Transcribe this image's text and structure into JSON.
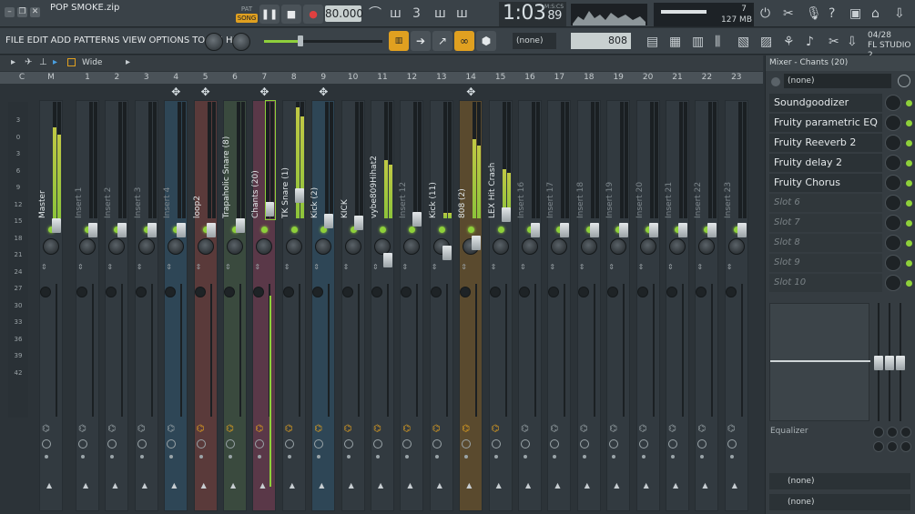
{
  "window": {
    "title": "POP SMOKE.zip"
  },
  "transport": {
    "pat_label": "PAT",
    "song_label": "SONG",
    "tempo": "80.000",
    "time": "1:03",
    "time_small": "89",
    "time_unit": "M:S:CS",
    "hint_cpu": "7",
    "hint_mem": "127 MB",
    "hint_poly": "6"
  },
  "menu": {
    "items": [
      "FILE",
      "EDIT",
      "ADD",
      "PATTERNS",
      "VIEW",
      "OPTIONS",
      "TOOLS",
      "HELP"
    ]
  },
  "toolbar": {
    "pattern_select": "(none)",
    "pattern_number": "808",
    "date": "04/28",
    "studio": "FL STUDIO 2.."
  },
  "mixer": {
    "view_mode": "Wide",
    "db_scale": [
      "3",
      "0",
      "3",
      "6",
      "9",
      "12",
      "15",
      "18",
      "21",
      "24",
      "27",
      "30",
      "33",
      "36",
      "39",
      "42"
    ],
    "strips": [
      {
        "num": "C",
        "label": ""
      },
      {
        "num": "M",
        "label": "Master"
      },
      {
        "num": "1",
        "label": "Insert 1"
      },
      {
        "num": "2",
        "label": "Insert 2"
      },
      {
        "num": "3",
        "label": "Insert 3"
      },
      {
        "num": "4",
        "label": "Insert 4"
      },
      {
        "num": "5",
        "label": "loop2"
      },
      {
        "num": "6",
        "label": "Trapaholic Snare (8)"
      },
      {
        "num": "7",
        "label": "Chants (20)"
      },
      {
        "num": "8",
        "label": "TK Snare (1)"
      },
      {
        "num": "9",
        "label": "Kick (2)"
      },
      {
        "num": "10",
        "label": "KICK"
      },
      {
        "num": "11",
        "label": "vybe809Hihat2"
      },
      {
        "num": "12",
        "label": "Insert 12"
      },
      {
        "num": "13",
        "label": "Kick (11)"
      },
      {
        "num": "14",
        "label": "808 (2)"
      },
      {
        "num": "15",
        "label": "LEX Hit Crash"
      },
      {
        "num": "16",
        "label": "Insert 16"
      },
      {
        "num": "17",
        "label": "Insert 17"
      },
      {
        "num": "18",
        "label": "Insert 18"
      },
      {
        "num": "19",
        "label": "Insert 19"
      },
      {
        "num": "20",
        "label": "Insert 20"
      },
      {
        "num": "21",
        "label": "Insert 21"
      },
      {
        "num": "22",
        "label": "Insert 22"
      },
      {
        "num": "23",
        "label": "Insert 23"
      }
    ]
  },
  "panel": {
    "title": "Mixer - Chants (20)",
    "input": "(none)",
    "slots": [
      "Soundgoodizer",
      "Fruity parametric EQ 2",
      "Fruity Reeverb 2",
      "Fruity delay 2",
      "Fruity Chorus",
      "Slot 6",
      "Slot 7",
      "Slot 8",
      "Slot 9",
      "Slot 10"
    ],
    "eq_label": "Equalizer",
    "output1": "(none)",
    "output2": "(none)"
  }
}
